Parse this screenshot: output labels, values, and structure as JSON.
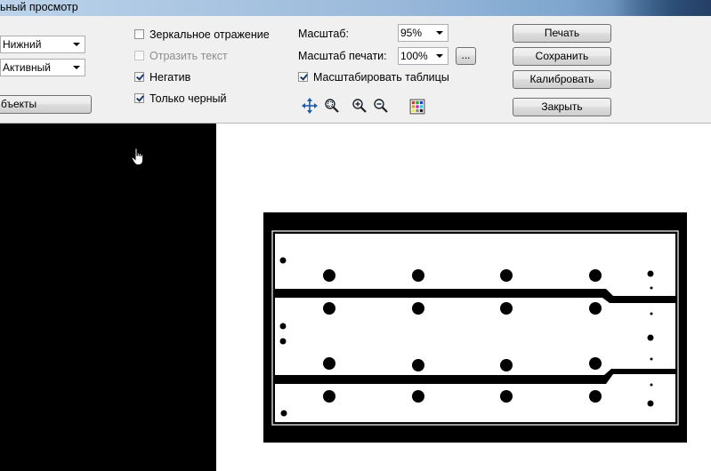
{
  "window": {
    "title": "ьный просмотр"
  },
  "left_panel": {
    "side_combo_value": "Нижний",
    "layer_combo_value": "Активный",
    "objects_button_label": "бъекты"
  },
  "options": {
    "mirror": {
      "label": "Зеркальное отражение",
      "checked": false,
      "enabled": true
    },
    "mirror_text": {
      "label": "Отразить текст",
      "checked": false,
      "enabled": false
    },
    "negative": {
      "label": "Негатив",
      "checked": true,
      "enabled": true
    },
    "only_black": {
      "label": "Только черный",
      "checked": true,
      "enabled": true
    }
  },
  "scale": {
    "scale_label": "Масштаб:",
    "scale_value": "95%",
    "print_scale_label": "Масштаб печати:",
    "print_scale_value": "100%",
    "more_button_label": "...",
    "scale_tables": {
      "label": "Масштабировать таблицы",
      "checked": true
    }
  },
  "tools": [
    {
      "name": "move-icon"
    },
    {
      "name": "zoom-area-icon"
    },
    {
      "name": "zoom-in-icon"
    },
    {
      "name": "zoom-out-icon"
    },
    {
      "name": "color-palette-icon"
    }
  ],
  "actions": {
    "print": "Печать",
    "save": "Сохранить",
    "calibrate": "Калибровать",
    "close": "Закрыть"
  },
  "colors": {
    "accent_check": "#1c3a72",
    "preview_bg": "#ffffff",
    "negative_area": "#000000"
  }
}
